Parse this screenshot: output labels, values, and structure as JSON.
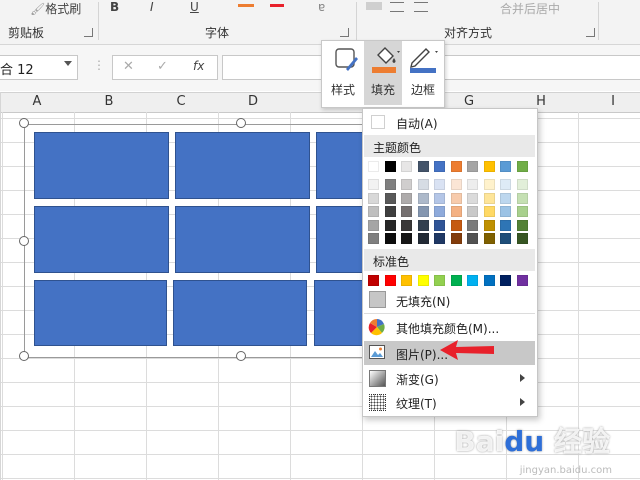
{
  "ribbon": {
    "format_painter_label": "格式刷",
    "bold_label": "B",
    "merge_center_label": "合并后居中",
    "groups": {
      "clipboard": "剪贴板",
      "font": "字体",
      "alignment": "对齐方式"
    }
  },
  "formula_bar": {
    "name_box": "合 12",
    "fx_label": "fx",
    "cancel_label": "✕",
    "enter_label": "✓",
    "formula_value": ""
  },
  "columns": [
    "A",
    "B",
    "C",
    "D",
    "G",
    "H",
    "I"
  ],
  "colors": {
    "shape_fill": "#4472c4",
    "fill_accent": "#ed7d31",
    "border_accent": "#4472c4",
    "highlight": "#c8c8c8",
    "arrow": "#e8212b"
  },
  "mini_toolbar": {
    "style_label": "样式",
    "fill_label": "填充",
    "border_label": "边框"
  },
  "fill_menu": {
    "auto_label": "自动(A)",
    "theme_colors_header": "主题颜色",
    "theme_row": [
      "#ffffff",
      "#000000",
      "#e7e6e6",
      "#44546a",
      "#4472c4",
      "#ed7d31",
      "#a5a5a5",
      "#ffc000",
      "#5b9bd5",
      "#70ad47"
    ],
    "theme_shades": [
      [
        "#f2f2f2",
        "#7f7f7f",
        "#d0cece",
        "#d6dce4",
        "#d9e2f3",
        "#fbe5d5",
        "#ededed",
        "#fff2cc",
        "#deebf6",
        "#e2efd9"
      ],
      [
        "#d8d8d8",
        "#595959",
        "#aeabab",
        "#adb9ca",
        "#b4c6e7",
        "#f7cbac",
        "#dbdbdb",
        "#fee599",
        "#bdd7ee",
        "#c5e0b3"
      ],
      [
        "#bfbfbf",
        "#3f3f3f",
        "#757070",
        "#8496b0",
        "#8eaadb",
        "#f4b183",
        "#c9c9c9",
        "#ffd965",
        "#9cc3e5",
        "#a8d08d"
      ],
      [
        "#a5a5a5",
        "#262626",
        "#3a3838",
        "#323f4f",
        "#2f5496",
        "#c55a11",
        "#7b7b7b",
        "#bf9000",
        "#2e75b5",
        "#538135"
      ],
      [
        "#7f7f7f",
        "#0c0c0c",
        "#171616",
        "#222a35",
        "#1f3864",
        "#833c0b",
        "#525252",
        "#7f6000",
        "#1e4e79",
        "#375623"
      ]
    ],
    "standard_colors_header": "标准色",
    "standard_row": [
      "#c00000",
      "#ff0000",
      "#ffc000",
      "#ffff00",
      "#92d050",
      "#00b050",
      "#00b0f0",
      "#0070c0",
      "#002060",
      "#7030a0"
    ],
    "no_fill_label": "无填充(N)",
    "more_colors_label": "其他填充颜色(M)...",
    "picture_label": "图片(P)...",
    "gradient_label": "渐变(G)",
    "texture_label": "纹理(T)"
  }
}
